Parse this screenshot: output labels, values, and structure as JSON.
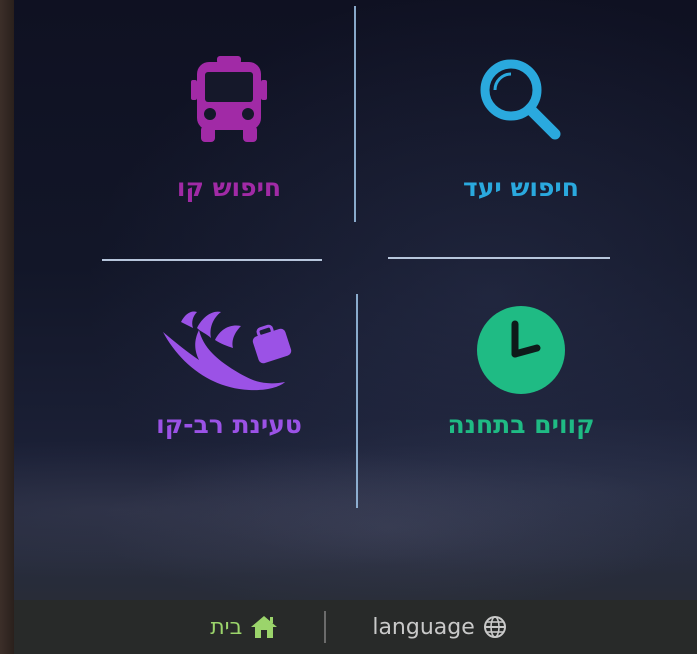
{
  "tiles": {
    "route_search": {
      "label": "חיפוש קו",
      "icon": "bus-icon",
      "color": "#a12aa6"
    },
    "destination_search": {
      "label": "חיפוש יעד",
      "icon": "search-icon",
      "color": "#2aa9de"
    },
    "multi_line_load": {
      "label": "טעינת רב-קו",
      "icon": "hand-card-icon",
      "color": "#9b52e6"
    },
    "station_lines": {
      "label": "קווים בתחנה",
      "icon": "clock-icon",
      "color": "#1fbb84"
    }
  },
  "footer": {
    "home_label": "בית",
    "home_icon": "home-icon",
    "language_label": "language",
    "language_icon": "globe-icon"
  }
}
